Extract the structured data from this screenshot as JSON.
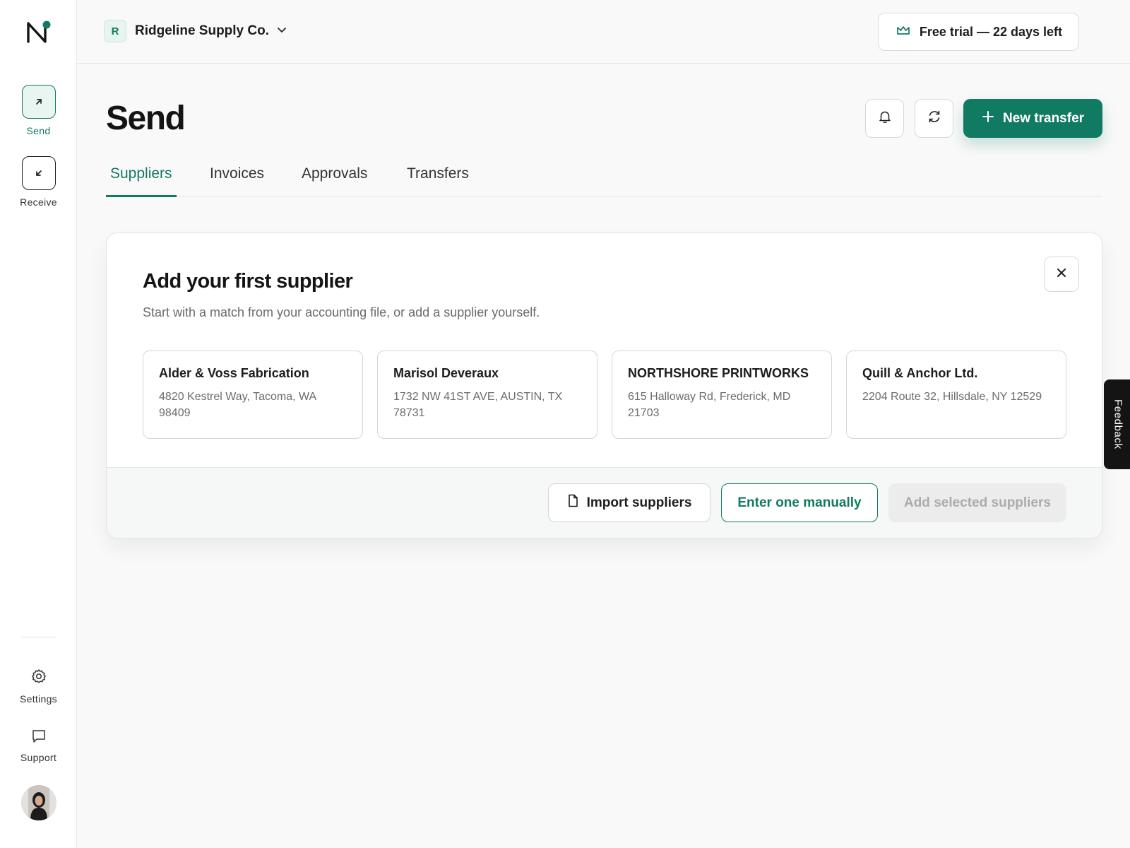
{
  "sidebar": {
    "logo": "N",
    "items": [
      {
        "label": "Send",
        "icon": "arrow-up-right-icon"
      },
      {
        "label": "Receive",
        "icon": "arrow-down-left-icon"
      }
    ],
    "settings_label": "Settings",
    "support_label": "Support"
  },
  "header": {
    "org_initial": "R",
    "org_name": "Ridgeline Supply Co.",
    "trial_text": "Free trial — 22 days left"
  },
  "page": {
    "title": "Send",
    "new_transfer_label": "New transfer",
    "tabs": [
      {
        "label": "Suppliers"
      },
      {
        "label": "Invoices"
      },
      {
        "label": "Approvals"
      },
      {
        "label": "Transfers"
      }
    ]
  },
  "card": {
    "title": "Add your first supplier",
    "subtitle": "Start with a match from your accounting file, or add a supplier yourself.",
    "suppliers": [
      {
        "name": "Alder & Voss Fabrication",
        "address": "4820 Kestrel Way, Tacoma, WA 98409"
      },
      {
        "name": "Marisol Deveraux",
        "address": "1732 NW 41ST AVE, AUSTIN, TX 78731"
      },
      {
        "name": "NORTHSHORE PRINTWORKS",
        "address": "615 Halloway Rd, Frederick, MD 21703"
      },
      {
        "name": "Quill & Anchor Ltd.",
        "address": "2204 Route 32, Hillsdale, NY 12529"
      }
    ],
    "import_label": "Import suppliers",
    "manual_label": "Enter one manually",
    "add_selected_label": "Add selected suppliers"
  },
  "feedback_label": "Feedback",
  "colors": {
    "accent": "#117a63",
    "accent_light": "#e9f5f1",
    "background": "#f9f9f9",
    "disabled_bg": "#ececec"
  }
}
